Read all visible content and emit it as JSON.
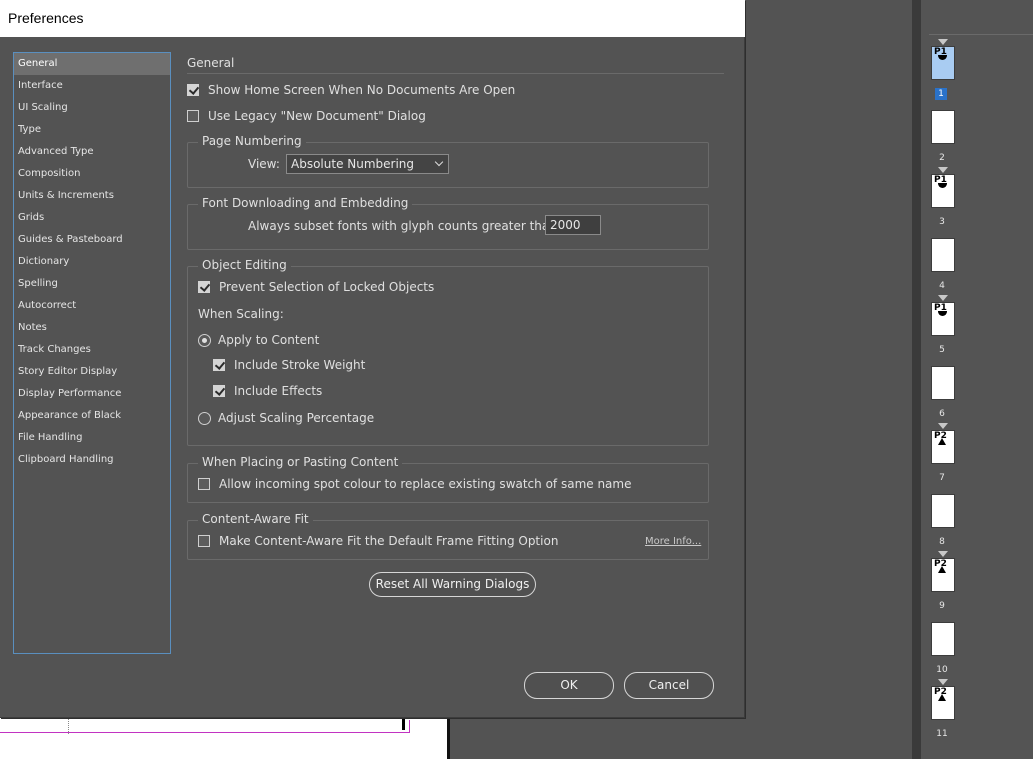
{
  "dialog": {
    "title": "Preferences",
    "sidebar": {
      "items": [
        {
          "label": "General",
          "active": true
        },
        {
          "label": "Interface"
        },
        {
          "label": "UI Scaling"
        },
        {
          "label": "Type"
        },
        {
          "label": "Advanced Type"
        },
        {
          "label": "Composition"
        },
        {
          "label": "Units & Increments"
        },
        {
          "label": "Grids"
        },
        {
          "label": "Guides & Pasteboard"
        },
        {
          "label": "Dictionary"
        },
        {
          "label": "Spelling"
        },
        {
          "label": "Autocorrect"
        },
        {
          "label": "Notes"
        },
        {
          "label": "Track Changes"
        },
        {
          "label": "Story Editor Display"
        },
        {
          "label": "Display Performance"
        },
        {
          "label": "Appearance of Black"
        },
        {
          "label": "File Handling"
        },
        {
          "label": "Clipboard Handling"
        }
      ]
    },
    "general": {
      "heading": "General",
      "show_home_screen": {
        "label": "Show Home Screen When No Documents Are Open",
        "checked": true
      },
      "legacy_new_doc": {
        "label": "Use Legacy \"New Document\" Dialog",
        "checked": false
      },
      "page_numbering": {
        "title": "Page Numbering",
        "view_label": "View:",
        "view_value": "Absolute Numbering"
      },
      "font_downloading": {
        "title": "Font Downloading and Embedding",
        "subset_label": "Always subset fonts with glyph counts greater than:",
        "subset_value": "2000"
      },
      "object_editing": {
        "title": "Object Editing",
        "prevent_locked": {
          "label": "Prevent Selection of Locked Objects",
          "checked": true
        },
        "when_scaling_label": "When Scaling:",
        "apply_to_content": {
          "label": "Apply to Content",
          "selected": true
        },
        "include_stroke": {
          "label": "Include Stroke Weight",
          "checked": true
        },
        "include_effects": {
          "label": "Include Effects",
          "checked": true
        },
        "adjust_scaling": {
          "label": "Adjust Scaling Percentage",
          "selected": false
        }
      },
      "placing": {
        "title": "When Placing or Pasting Content",
        "spot_colour": {
          "label": "Allow incoming spot colour to replace existing swatch of same name",
          "checked": false
        }
      },
      "content_aware": {
        "title": "Content-Aware Fit",
        "default_option": {
          "label": "Make Content-Aware Fit the Default Frame Fitting Option",
          "checked": false
        },
        "more_info": "More Info..."
      },
      "reset_warnings": "Reset All Warning Dialogs"
    },
    "ok": "OK",
    "cancel": "Cancel"
  },
  "pages_panel": {
    "pages": [
      {
        "label": "1",
        "master": "P1",
        "selected": true
      },
      {
        "label": "2",
        "master": ""
      },
      {
        "label": "3",
        "master": "P1"
      },
      {
        "label": "4",
        "master": ""
      },
      {
        "label": "5",
        "master": "P1"
      },
      {
        "label": "6",
        "master": ""
      },
      {
        "label": "7",
        "master": "P2"
      },
      {
        "label": "8",
        "master": ""
      },
      {
        "label": "9",
        "master": "P2"
      },
      {
        "label": "10",
        "master": ""
      },
      {
        "label": "11",
        "master": "P2"
      }
    ]
  }
}
